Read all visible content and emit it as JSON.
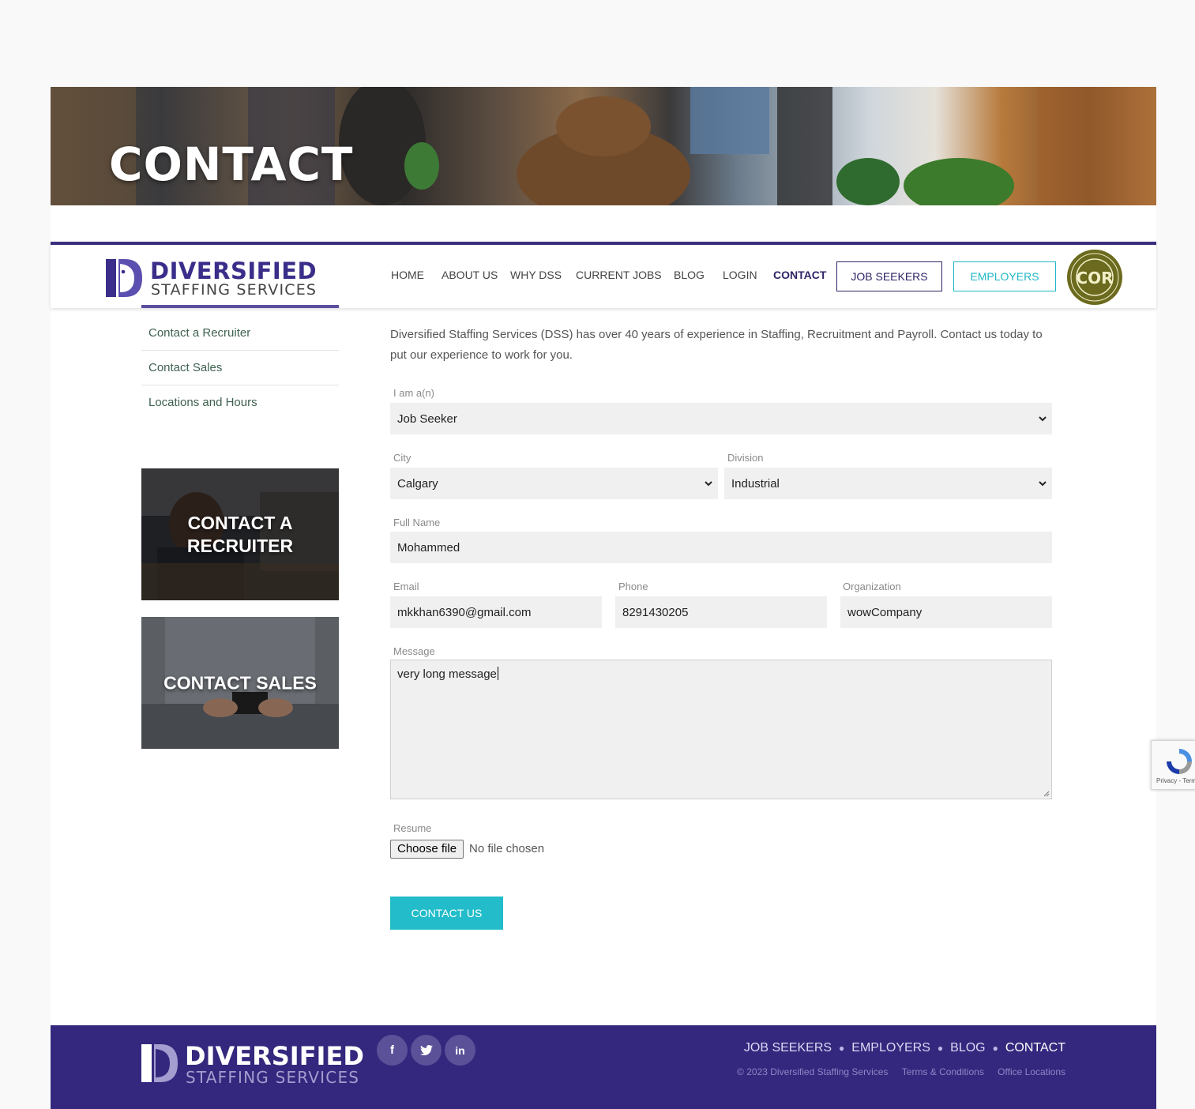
{
  "hero": {
    "title": "CONTACT"
  },
  "logo": {
    "word1": "DIVERSIFIED",
    "word2": "STAFFING SERVICES"
  },
  "nav": {
    "items": [
      {
        "label": "HOME"
      },
      {
        "label": "ABOUT US"
      },
      {
        "label": "WHY DSS"
      },
      {
        "label": "CURRENT JOBS"
      },
      {
        "label": "BLOG"
      },
      {
        "label": "LOGIN"
      },
      {
        "label": "CONTACT"
      }
    ],
    "job_seekers": "JOB SEEKERS",
    "employers": "EMPLOYERS",
    "badge": "COR"
  },
  "sidebar": {
    "items": [
      {
        "label": "Contact a Recruiter"
      },
      {
        "label": "Contact Sales"
      },
      {
        "label": "Locations and Hours"
      }
    ],
    "card1": "CONTACT A RECRUITER",
    "card2": "CONTACT SALES"
  },
  "form": {
    "intro": "Diversified Staffing Services (DSS) has over 40 years of experience in Staffing, Recruitment and Payroll. Contact us today to put our experience to work for you.",
    "iam_label": "I am a(n)",
    "iam_value": "Job Seeker",
    "city_label": "City",
    "city_value": "Calgary",
    "division_label": "Division",
    "division_value": "Industrial",
    "fullname_label": "Full Name",
    "fullname_value": "Mohammed",
    "email_label": "Email",
    "email_value": "mkkhan6390@gmail.com",
    "phone_label": "Phone",
    "phone_value": "8291430205",
    "org_label": "Organization",
    "org_value": "wowCompany",
    "message_label": "Message",
    "message_value": "very long message",
    "resume_label": "Resume",
    "file_button": "Choose file",
    "file_status": "No file chosen",
    "submit": "CONTACT US"
  },
  "footer": {
    "logo_word1": "DIVERSIFIED",
    "logo_word2": "STAFFING SERVICES",
    "social": [
      "f",
      "in"
    ],
    "nav": [
      "JOB SEEKERS",
      "EMPLOYERS",
      "BLOG",
      "CONTACT"
    ],
    "copyright": "© 2023 Diversified Staffing Services",
    "terms": "Terms & Conditions",
    "offices": "Office Locations"
  },
  "recaptcha": {
    "text": "Privacy - Terms"
  },
  "colors": {
    "brand": "#33287d",
    "accent": "#22bcca"
  }
}
